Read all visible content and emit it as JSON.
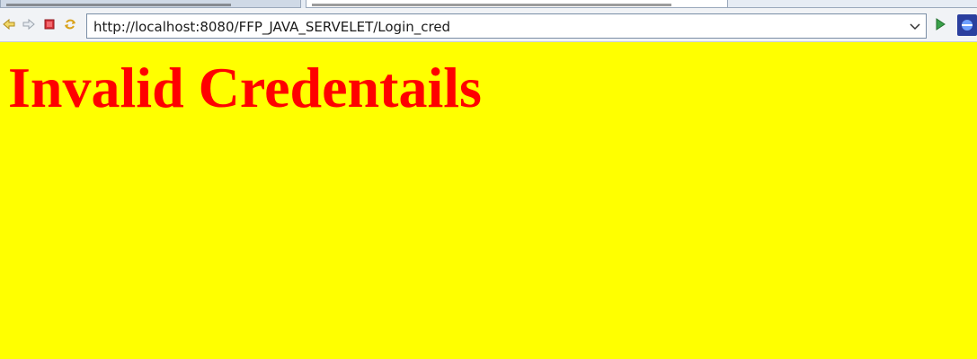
{
  "browser": {
    "address_bar": {
      "url": "http://localhost:8080/FFP_JAVA_SERVELET/Login_cred"
    },
    "icons": {
      "back": "back-arrow-icon",
      "forward": "forward-arrow-icon",
      "stop": "stop-icon",
      "refresh": "refresh-icon",
      "dropdown": "chevron-down-icon",
      "go": "go-play-icon",
      "extension": "extension-icon"
    }
  },
  "page": {
    "heading": "Invalid Credentails",
    "background_color": "#ffff00",
    "heading_color": "#ff0000"
  }
}
